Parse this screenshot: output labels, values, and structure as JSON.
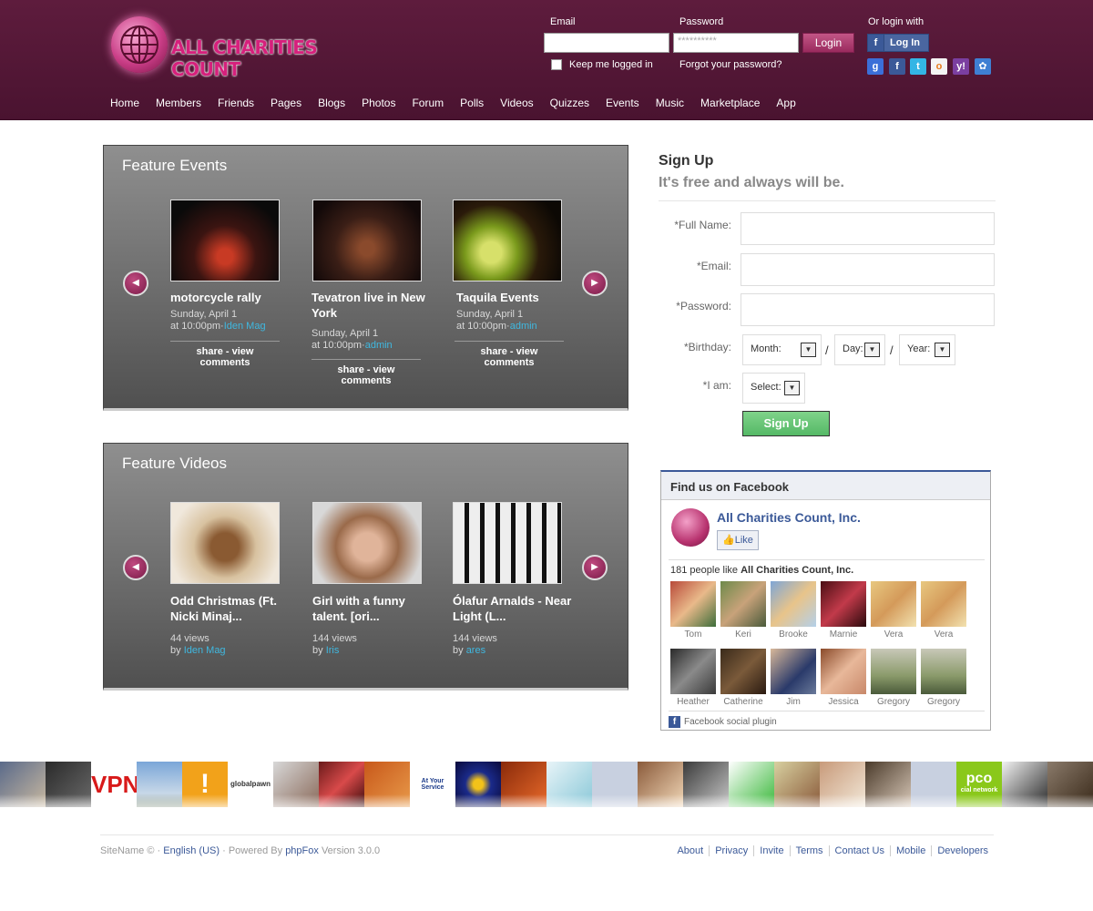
{
  "brand": {
    "name": "ALL CHARITIES COUNT"
  },
  "login": {
    "email_label": "Email",
    "password_label": "Password",
    "password_value": "**********",
    "login_button": "Login",
    "keep_logged_in": "Keep me logged in",
    "forgot_password": "Forgot your password?",
    "or_login_with": "Or login with",
    "fb_login": "Log In",
    "social_icons": [
      "google-icon",
      "facebook-icon",
      "twitter-icon",
      "openid-icon",
      "yahoo-icon",
      "windows-live-icon"
    ]
  },
  "nav": [
    "Home",
    "Members",
    "Friends",
    "Pages",
    "Blogs",
    "Photos",
    "Forum",
    "Polls",
    "Videos",
    "Quizzes",
    "Events",
    "Music",
    "Marketplace",
    "App"
  ],
  "feature_events": {
    "title": "Feature Events",
    "items": [
      {
        "title": "motorcycle rally",
        "date": "Sunday, April 1",
        "time": "at 10:00pm",
        "sep": "·",
        "author": "Iden Mag",
        "share": "share - view comments"
      },
      {
        "title": "Tevatron live in New York",
        "date": "Sunday, April 1",
        "time": "at 10:00pm",
        "sep": "·",
        "author": "admin",
        "share": "share - view comments"
      },
      {
        "title": "Taquila Events",
        "date": "Sunday, April 1",
        "time": "at 10:00pm",
        "sep": "·",
        "author": "admin",
        "share": "share - view comments"
      }
    ]
  },
  "feature_videos": {
    "title": "Feature Videos",
    "items": [
      {
        "title": "Odd Christmas (Ft. Nicki Minaj...",
        "views": "44 views",
        "by": "by",
        "author": "Iden Mag"
      },
      {
        "title": "Girl with a funny talent. [ori...",
        "views": "144 views",
        "by": "by",
        "author": "Iris"
      },
      {
        "title": "Ólafur Arnalds - Near Light (L...",
        "views": "144 views",
        "by": "by",
        "author": "ares"
      }
    ]
  },
  "signup": {
    "title": "Sign Up",
    "subtitle": "It's free and always will be.",
    "full_name": "*Full Name:",
    "email": "*Email:",
    "password": "*Password:",
    "birthday": "*Birthday:",
    "month": "Month:",
    "day": "Day:",
    "year": "Year:",
    "slash": "/",
    "i_am": "*I am:",
    "select": "Select:",
    "button": "Sign Up"
  },
  "facebook": {
    "header": "Find us on Facebook",
    "page_name": "All Charities Count, Inc.",
    "like": "Like",
    "count_prefix": "181 people like ",
    "count_page": "All Charities Count, Inc.",
    "fans": [
      "Tom",
      "Keri",
      "Brooke",
      "Marnie",
      "Vera",
      "Vera",
      "Heather",
      "Catherine",
      "Jim",
      "Jessica",
      "Gregory",
      "Gregory"
    ],
    "plugin_label": "Facebook social plugin"
  },
  "strip_text": [
    "VPN",
    "!",
    "globalpawn",
    "At Your Service",
    "pco",
    "cial network"
  ],
  "footer": {
    "sitename": "SiteName ©",
    "dot": "·",
    "language": "English (US)",
    "powered": "Powered By",
    "phpfox": "phpFox",
    "version": "Version 3.0.0",
    "links": [
      "About",
      "Privacy",
      "Invite",
      "Terms",
      "Contact Us",
      "Mobile",
      "Developers"
    ]
  }
}
